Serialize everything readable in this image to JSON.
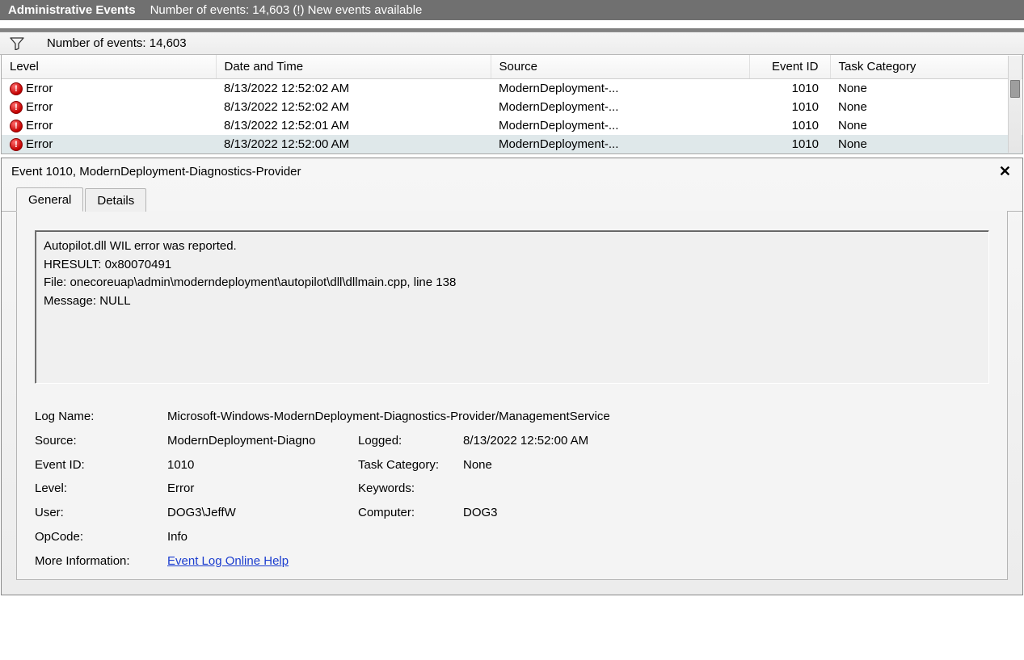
{
  "titlebar": {
    "title": "Administrative Events",
    "subtitle": "Number of events: 14,603 (!) New events available"
  },
  "toolbar": {
    "filter_icon": "funnel-icon",
    "label": "Number of events: 14,603"
  },
  "grid": {
    "columns": [
      "Level",
      "Date and Time",
      "Source",
      "Event ID",
      "Task Category"
    ],
    "rows": [
      {
        "level": "Error",
        "datetime": "8/13/2022 12:52:02 AM",
        "source": "ModernDeployment-...",
        "event_id": "1010",
        "task_category": "None",
        "selected": false
      },
      {
        "level": "Error",
        "datetime": "8/13/2022 12:52:02 AM",
        "source": "ModernDeployment-...",
        "event_id": "1010",
        "task_category": "None",
        "selected": false
      },
      {
        "level": "Error",
        "datetime": "8/13/2022 12:52:01 AM",
        "source": "ModernDeployment-...",
        "event_id": "1010",
        "task_category": "None",
        "selected": false
      },
      {
        "level": "Error",
        "datetime": "8/13/2022 12:52:00 AM",
        "source": "ModernDeployment-...",
        "event_id": "1010",
        "task_category": "None",
        "selected": true
      }
    ]
  },
  "detail": {
    "title": "Event 1010, ModernDeployment-Diagnostics-Provider",
    "close": "✕",
    "tabs": {
      "general": "General",
      "details": "Details"
    },
    "message": "Autopilot.dll WIL error was reported.\nHRESULT: 0x80070491\nFile: onecoreuap\\admin\\moderndeployment\\autopilot\\dll\\dllmain.cpp, line 138\nMessage: NULL",
    "props": {
      "log_name_label": "Log Name:",
      "log_name": "Microsoft-Windows-ModernDeployment-Diagnostics-Provider/ManagementService",
      "source_label": "Source:",
      "source": "ModernDeployment-Diagno",
      "logged_label": "Logged:",
      "logged": "8/13/2022 12:52:00 AM",
      "event_id_label": "Event ID:",
      "event_id": "1010",
      "task_cat_label": "Task Category:",
      "task_cat": "None",
      "level_label": "Level:",
      "level": "Error",
      "keywords_label": "Keywords:",
      "keywords": "",
      "user_label": "User:",
      "user": "DOG3\\JeffW",
      "computer_label": "Computer:",
      "computer": "DOG3",
      "opcode_label": "OpCode:",
      "opcode": "Info",
      "more_info_label": "More Information:",
      "more_info_link": "Event Log Online Help"
    }
  }
}
